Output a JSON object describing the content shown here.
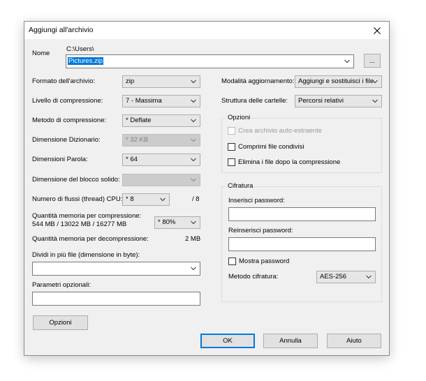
{
  "window": {
    "title": "Aggiungi all'archivio"
  },
  "name": {
    "label": "Nome",
    "path": "C:\\Users\\",
    "value": "Pictures.zip",
    "browse_label": "..."
  },
  "left": {
    "format": {
      "label": "Formato dell'archivio:",
      "value": "zip"
    },
    "level": {
      "label": "Livello di compressione:",
      "value": "7 - Massima"
    },
    "method": {
      "label": "Metodo di compressione:",
      "value": "* Deflate"
    },
    "dict": {
      "label": "Dimensione Dizionario:",
      "value": "* 32 KB"
    },
    "word": {
      "label": "Dimensioni Parola:",
      "value": "* 64"
    },
    "solid": {
      "label": "Dimensione del blocco solido:",
      "value": ""
    },
    "threads": {
      "label": "Numero di flussi (thread) CPU:",
      "value": "* 8",
      "max": "/ 8"
    },
    "mem_comp": {
      "label": "Quantità memoria per compressione:",
      "detail": "544 MB / 13022 MB / 16277 MB",
      "value": "* 80%"
    },
    "mem_decomp": {
      "label": "Quantità memoria per decompressione:",
      "value": "2 MB"
    },
    "split": {
      "label": "Dividi in più file (dimensione in byte):",
      "value": ""
    },
    "params": {
      "label": "Parametri opzionali:",
      "value": ""
    },
    "options_button": "Opzioni"
  },
  "right": {
    "update_mode": {
      "label": "Modalità aggiornamento:",
      "value": "Aggiungi e sostituisci i file"
    },
    "folders": {
      "label": "Struttura delle cartelle:",
      "value": "Percorsi relativi"
    },
    "options_group": {
      "title": "Opzioni",
      "sfx": "Crea archivio auto-estraente",
      "shared": "Comprimi file condivisi",
      "delete": "Elimina i file dopo la compressione"
    },
    "encryption": {
      "title": "Cifratura",
      "password_label": "Inserisci password:",
      "repassword_label": "Reinserisci password:",
      "show_password": "Mostra password",
      "method_label": "Metodo cifratura:",
      "method_value": "AES-256"
    }
  },
  "footer": {
    "ok": "OK",
    "cancel": "Annulla",
    "help": "Aiuto"
  }
}
